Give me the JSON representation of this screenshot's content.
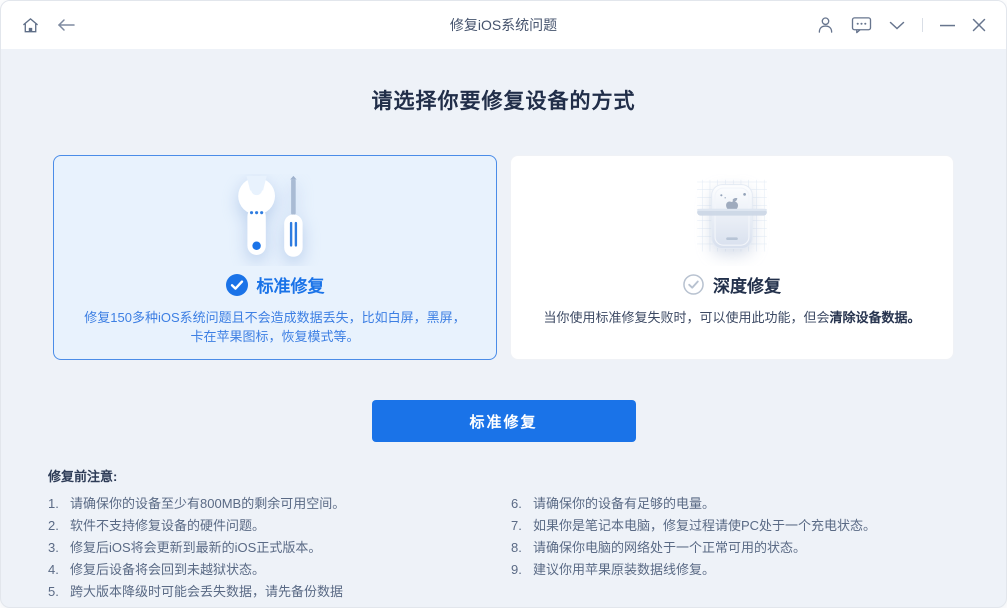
{
  "titlebar": {
    "title": "修复iOS系统问题",
    "icons": {
      "home": "home-icon",
      "back": "back-arrow-icon",
      "account": "person-icon",
      "feedback": "chat-bubble-icon",
      "menu": "chevron-down-icon",
      "minimize": "minimize-icon",
      "close": "close-icon"
    }
  },
  "heading": "请选择你要修复设备的方式",
  "cards": {
    "standard": {
      "title": "标准修复",
      "desc": "修复150多种iOS系统问题且不会造成数据丢失，比如白屏，黑屏，卡在苹果图标，恢复模式等。",
      "selected": true,
      "icon": "wrench-screwdriver-icon",
      "check_icon": "checkmark-filled-icon"
    },
    "deep": {
      "title": "深度修复",
      "desc_prefix": "当你使用标准修复失败时，可以使用此功能，但会",
      "desc_bold": "清除设备数据。",
      "selected": false,
      "icon": "device-restore-icon",
      "check_icon": "checkmark-outline-icon"
    }
  },
  "action_button": "标准修复",
  "notes": {
    "header": "修复前注意:",
    "left_numbers": [
      "1.",
      "2.",
      "3.",
      "4.",
      "5."
    ],
    "left": [
      "请确保你的设备至少有800MB的剩余可用空间。",
      "软件不支持修复设备的硬件问题。",
      "修复后iOS将会更新到最新的iOS正式版本。",
      "修复后设备将会回到未越狱状态。",
      "跨大版本降级时可能会丢失数据，请先备份数据"
    ],
    "right_numbers": [
      "6.",
      "7.",
      "8.",
      "9."
    ],
    "right": [
      "请确保你的设备有足够的电量。",
      "如果你是笔记本电脑，修复过程请使PC处于一个充电状态。",
      "请确保你电脑的网络处于一个正常可用的状态。",
      "建议你用苹果原装数据线修复。"
    ]
  },
  "colors": {
    "accent": "#1a73e8",
    "selected_card_bg": "#e8f2fd",
    "selected_card_border": "#4a8ce8",
    "content_bg": "#eef2f8",
    "note_text": "#5a6a85"
  }
}
